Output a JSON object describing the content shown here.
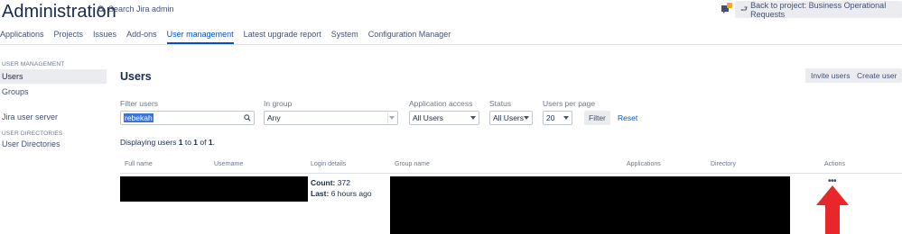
{
  "header": {
    "title": "Administration",
    "search_placeholder": "Search Jira admin",
    "back_button_label": "Back to project: Business Operational Requests",
    "notification_color": "#f5a623"
  },
  "tabs": [
    {
      "label": "Applications",
      "active": false
    },
    {
      "label": "Projects",
      "active": false
    },
    {
      "label": "Issues",
      "active": false
    },
    {
      "label": "Add-ons",
      "active": false
    },
    {
      "label": "User management",
      "active": true
    },
    {
      "label": "Latest upgrade report",
      "active": false
    },
    {
      "label": "System",
      "active": false
    },
    {
      "label": "Configuration Manager",
      "active": false
    }
  ],
  "sidebar": {
    "sections": [
      {
        "heading": "USER MANAGEMENT",
        "items": [
          {
            "label": "Users",
            "active": true
          },
          {
            "label": "Groups",
            "active": false
          },
          {
            "label": "Jira user server",
            "active": false
          }
        ]
      },
      {
        "heading": "USER DIRECTORIES",
        "items": [
          {
            "label": "User Directories",
            "active": false
          }
        ]
      }
    ]
  },
  "main": {
    "title": "Users",
    "invite_button": "Invite users",
    "create_button": "Create user",
    "filters": {
      "filter_users_label": "Filter users",
      "filter_users_value": "rebekah",
      "in_group_label": "In group",
      "in_group_value": "Any",
      "app_access_label": "Application access",
      "app_access_value": "All Users",
      "status_label": "Status",
      "status_value": "All Users",
      "per_page_label": "Users per page",
      "per_page_value": "20",
      "filter_button": "Filter",
      "reset_link": "Reset"
    },
    "display": {
      "prefix": "Displaying users ",
      "from": "1",
      "to_word": " to ",
      "to": "1",
      "of_word": " of ",
      "total": "1",
      "suffix": "."
    },
    "table": {
      "columns": [
        "Full name",
        "Username",
        "Login details",
        "Group name",
        "Applications",
        "Directory",
        "Actions"
      ],
      "row": {
        "count_label": "Count:",
        "count_value": "372",
        "last_label": "Last:",
        "last_value": "6 hours ago",
        "actions_label": "•••"
      }
    },
    "annotation_color": "#e8272b"
  }
}
